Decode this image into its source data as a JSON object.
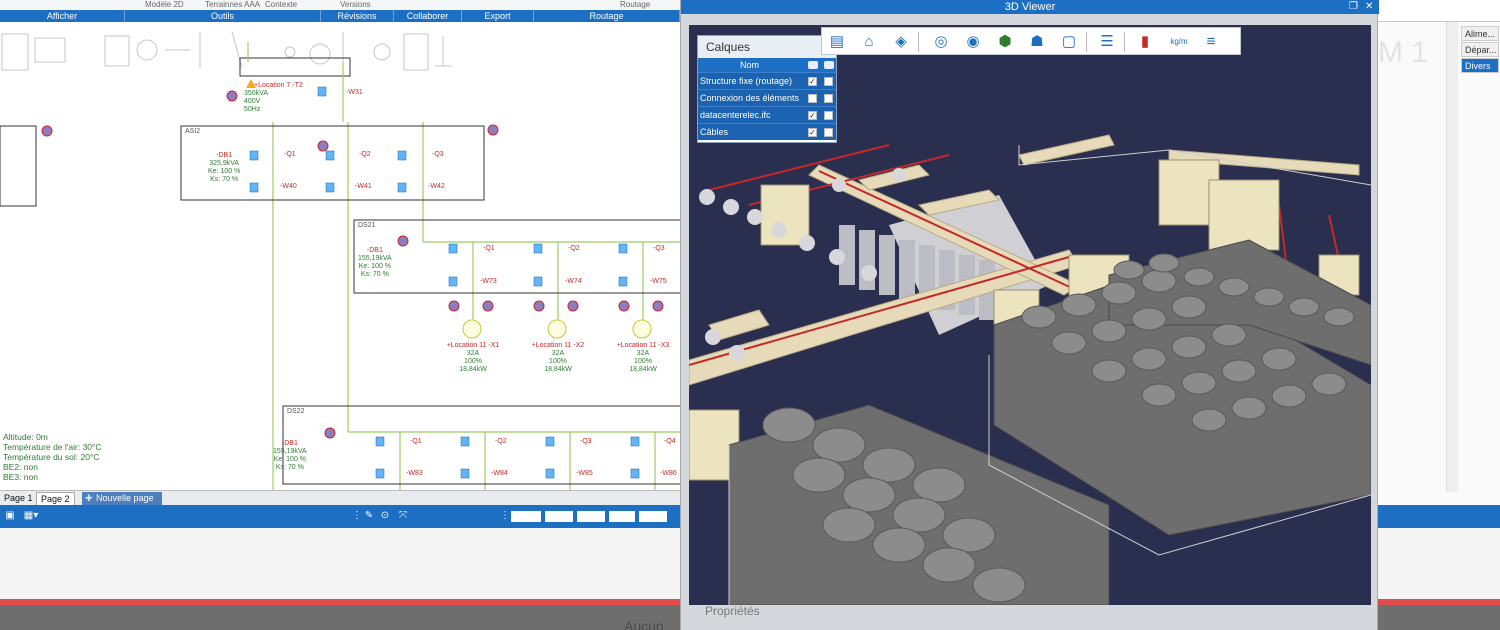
{
  "ribbon": {
    "tabs": [
      "Afficher",
      "Outils",
      "Révisions",
      "Collaborer",
      "Export",
      "Routage"
    ],
    "top_labels": [
      "Modèle 2D",
      "Terrainnes AAA",
      "Contexte",
      "Versions",
      "Routage"
    ]
  },
  "diagram": {
    "transformer": {
      "name": "+Location 7 -T2",
      "power": "350kVA",
      "voltage": "400V",
      "freq": "50Hz",
      "cable": "-W31"
    },
    "asi2": {
      "name": "ASI2",
      "board": "-DB1",
      "power": "325,9kVA",
      "ke": "Ke: 100 %",
      "ks": "Ks: 70 %",
      "breakers": [
        "-Q1",
        "-Q2",
        "-Q3"
      ],
      "cables": [
        "-W40",
        "-W41",
        "-W42"
      ]
    },
    "ds21": {
      "name": "DS21",
      "board": "-DB1",
      "power": "155,19kVA",
      "ke": "Ke: 100 %",
      "ks": "Ks: 70 %",
      "breakers": [
        "-Q1",
        "-Q2",
        "-Q3"
      ],
      "cables": [
        "-W73",
        "-W74",
        "-W75"
      ],
      "loads": [
        {
          "name": "+Location 11 -X1",
          "current": "32A",
          "pct": "100%",
          "power": "18,84kW"
        },
        {
          "name": "+Location 11 -X2",
          "current": "32A",
          "pct": "100%",
          "power": "18,84kW"
        },
        {
          "name": "+Location 11 -X3",
          "current": "32A",
          "pct": "100%",
          "power": "18,84kW"
        }
      ]
    },
    "ds22": {
      "name": "DS22",
      "board": "-DB1",
      "power": "155,19kVA",
      "ke": "Ke: 100 %",
      "ks": "Ks: 70 %",
      "breakers": [
        "-Q1",
        "-Q2",
        "-Q3",
        "-Q4"
      ],
      "cables": [
        "-W83",
        "-W84",
        "-W85",
        "-W86"
      ]
    },
    "environment": [
      "Altitude: 0m",
      "Température de l'air: 30°C",
      "Température du sol: 20°C",
      "BE2: non",
      "BE3: non"
    ]
  },
  "pages": {
    "tabs": [
      "Page 1",
      "Page 2"
    ],
    "active": "Page 2",
    "new_page": "Nouvelle page"
  },
  "viewer": {
    "title": "3D Viewer",
    "controls": {
      "restore": "❐",
      "close": "✕"
    },
    "layers": {
      "title": "Calques",
      "column_name": "Nom",
      "rows": [
        {
          "name": "Structure fixe (routage)",
          "visible": "✓",
          "transparent": ""
        },
        {
          "name": "Connexion des éléments",
          "visible": "",
          "transparent": ""
        },
        {
          "name": "datacenterelec.ifc",
          "visible": "✓",
          "transparent": ""
        },
        {
          "name": "Câbles",
          "visible": "✓",
          "transparent": ""
        }
      ]
    },
    "toolbar": [
      {
        "name": "table-icon",
        "glyph": "▤"
      },
      {
        "name": "home-icon",
        "glyph": "⌂"
      },
      {
        "name": "layers-icon",
        "glyph": "◈"
      },
      {
        "name": "hide-icon",
        "glyph": "◎"
      },
      {
        "name": "show-hidden-icon",
        "glyph": "◉"
      },
      {
        "name": "cube-icon",
        "glyph": "⬢"
      },
      {
        "name": "ghost-icon",
        "glyph": "☗"
      },
      {
        "name": "frame-icon",
        "glyph": "▢"
      },
      {
        "name": "settings-sliders-icon",
        "glyph": "☰"
      },
      {
        "name": "bar-chart-icon",
        "glyph": "▮"
      },
      {
        "name": "weight-per-meter-icon",
        "glyph": "kg/m"
      },
      {
        "name": "list-icon",
        "glyph": "≡"
      }
    ],
    "properties_label": "Propriétés"
  },
  "right_panel": {
    "big_text": "M 1",
    "tabs": [
      "Alime...",
      "Dépar...",
      "Divers"
    ],
    "selected": "Divers"
  },
  "lower": {
    "aucun_text": "Aucun"
  },
  "colors": {
    "accent": "#1d6fc4",
    "scene_bg": "#2b2f4f",
    "equipment": "#6b6b6b",
    "tray": "#e8dcc0",
    "cable": "#c62828",
    "line_green": "#9ccc65"
  }
}
